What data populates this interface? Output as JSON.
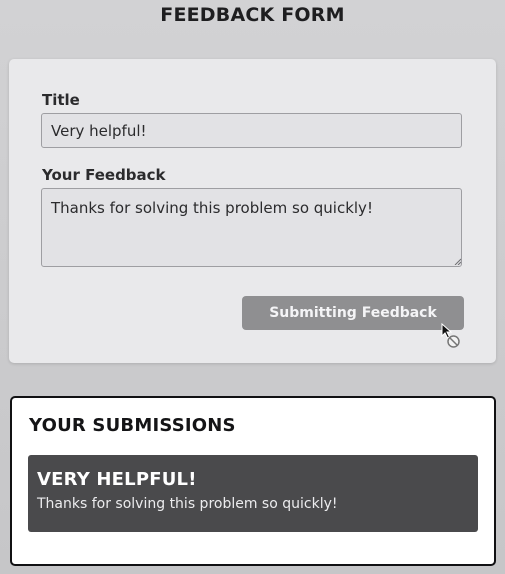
{
  "page": {
    "title": "FEEDBACK FORM"
  },
  "form": {
    "title_label": "Title",
    "title_value": "Very helpful!",
    "feedback_label": "Your Feedback",
    "feedback_value": "Thanks for solving this problem so quickly!",
    "submit_label": "Submitting Feedback",
    "submit_state": "disabled"
  },
  "submissions": {
    "heading": "YOUR SUBMISSIONS",
    "items": [
      {
        "title": "VERY HELPFUL!",
        "body": "Thanks for solving this problem so quickly!"
      }
    ]
  },
  "cursor": {
    "icon": "not-allowed-cursor-icon"
  },
  "colors": {
    "background": "#c9c9cb",
    "card": "#e9e9eb",
    "button_disabled": "#8f8f91",
    "submission_item": "#4a4a4c",
    "text_dark": "#1e1e20"
  }
}
